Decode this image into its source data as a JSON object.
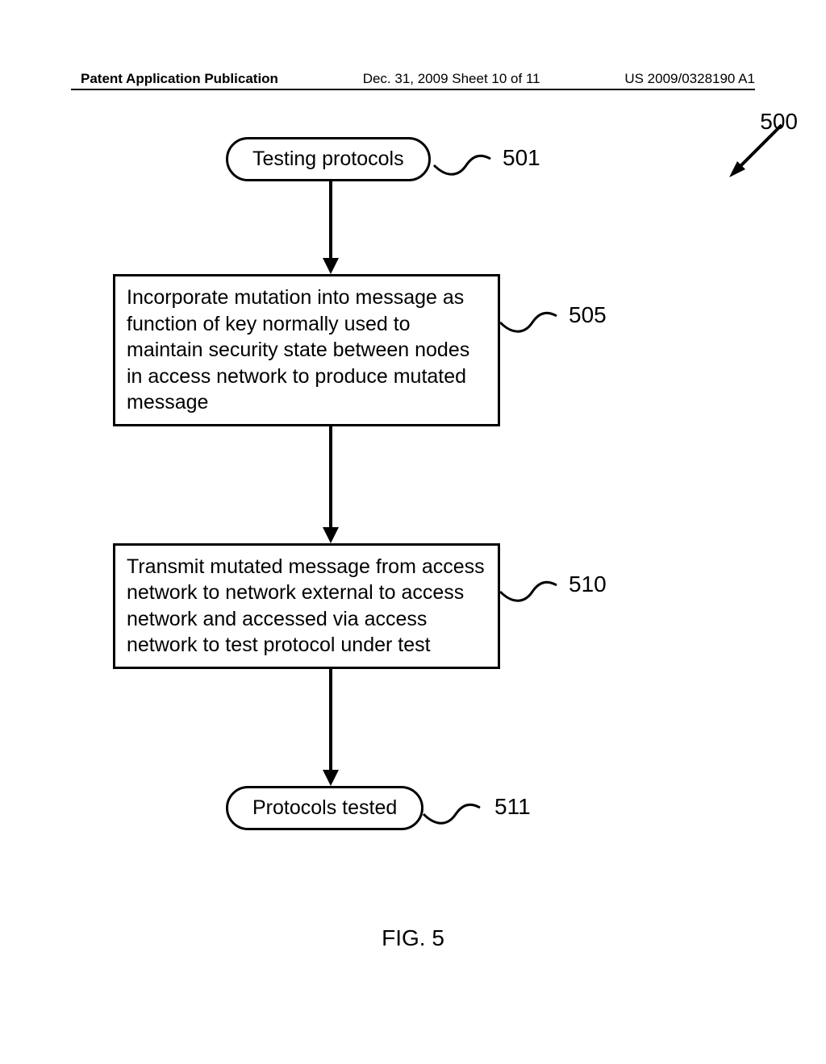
{
  "header": {
    "left": "Patent Application Publication",
    "center": "Dec. 31, 2009  Sheet 10 of 11",
    "right": "US 2009/0328190 A1"
  },
  "flowchart": {
    "ref": "500",
    "nodes": {
      "n501": {
        "label": "501",
        "text": "Testing protocols"
      },
      "n505": {
        "label": "505",
        "text": "Incorporate mutation into message as function of key normally used to maintain security state between nodes in access network to produce mutated message"
      },
      "n510": {
        "label": "510",
        "text": "Transmit mutated message from access network to network external to access network and accessed via access network to test protocol under test"
      },
      "n511": {
        "label": "511",
        "text": "Protocols tested"
      }
    }
  },
  "figure_label": "FIG. 5"
}
